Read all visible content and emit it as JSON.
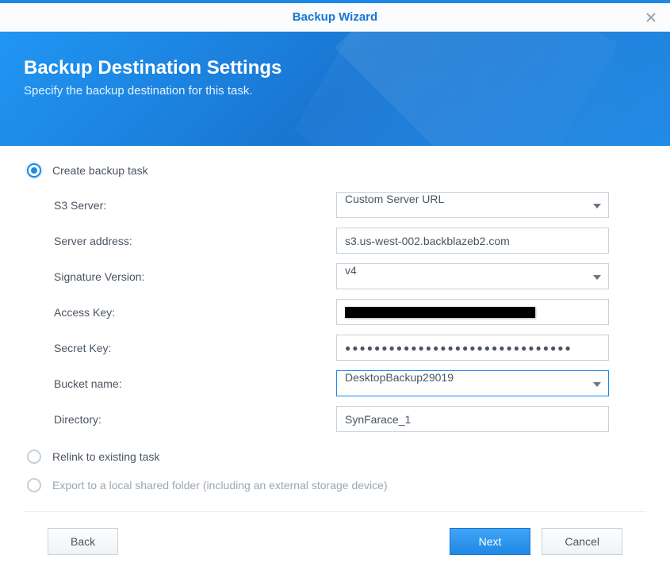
{
  "titlebar": {
    "title": "Backup Wizard"
  },
  "banner": {
    "title": "Backup Destination Settings",
    "subtitle": "Specify the backup destination for this task."
  },
  "options": {
    "create": {
      "label": "Create backup task",
      "selected": true
    },
    "relink": {
      "label": "Relink to existing task",
      "selected": false
    },
    "export_local": {
      "label": "Export to a local shared folder (including an external storage device)",
      "selected": false
    }
  },
  "form": {
    "s3_server": {
      "label": "S3 Server:",
      "value": "Custom Server URL"
    },
    "server_address": {
      "label": "Server address:",
      "value": "s3.us-west-002.backblazeb2.com"
    },
    "signature_version": {
      "label": "Signature Version:",
      "value": "v4"
    },
    "access_key": {
      "label": "Access Key:",
      "value": "[redacted]"
    },
    "secret_key": {
      "label": "Secret Key:",
      "value": "●●●●●●●●●●●●●●●●●●●●●●●●●●●●●●●"
    },
    "bucket_name": {
      "label": "Bucket name:",
      "value": "DesktopBackup29019"
    },
    "directory": {
      "label": "Directory:",
      "value": "SynFarace_1"
    }
  },
  "footer": {
    "back": "Back",
    "next": "Next",
    "cancel": "Cancel"
  }
}
